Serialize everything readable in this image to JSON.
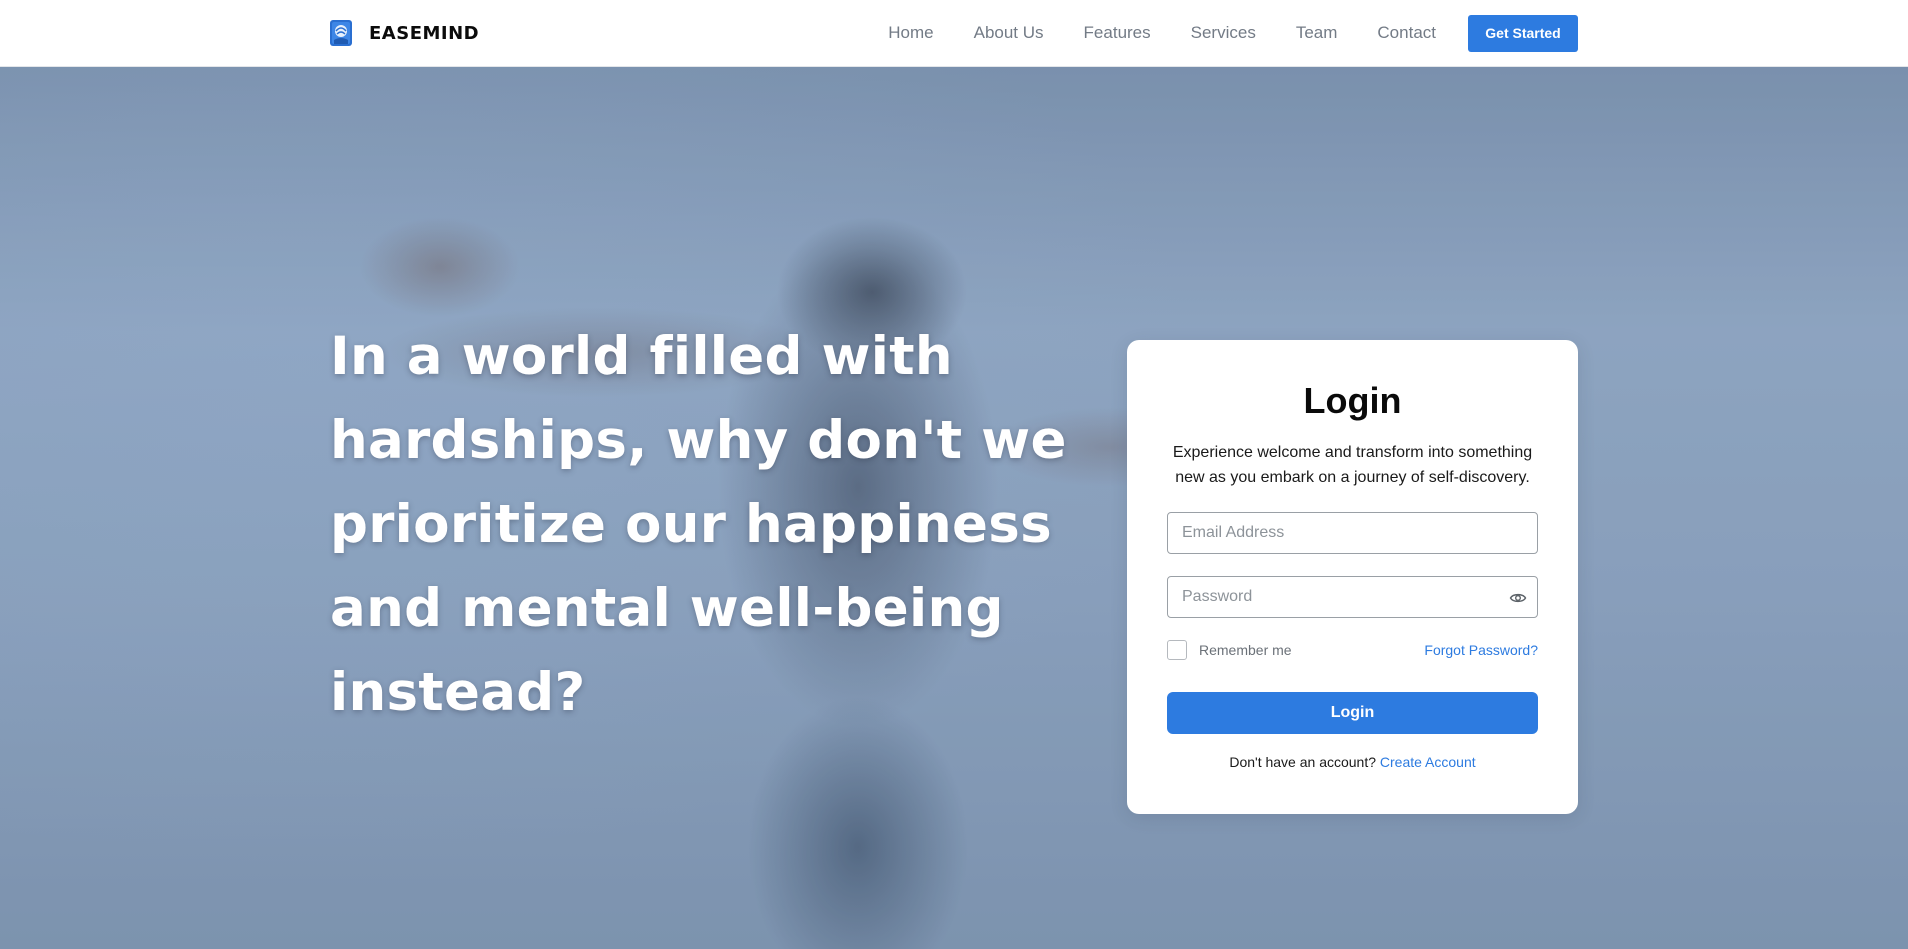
{
  "brand": {
    "name": "EASEMIND",
    "logo_icon": "easemind-logo-icon"
  },
  "nav": {
    "items": [
      {
        "label": "Home"
      },
      {
        "label": "About Us"
      },
      {
        "label": "Features"
      },
      {
        "label": "Services"
      },
      {
        "label": "Team"
      },
      {
        "label": "Contact"
      }
    ],
    "cta_label": "Get Started"
  },
  "hero": {
    "heading": "In a world filled with hardships, why don't we prioritize our happiness and mental well-being instead?"
  },
  "login": {
    "title": "Login",
    "subtitle": "Experience welcome and transform into something new as you embark on a journey of self-discovery.",
    "email_placeholder": "Email Address",
    "email_value": "",
    "password_placeholder": "Password",
    "password_value": "",
    "password_toggle_icon": "eye-icon",
    "remember_label": "Remember me",
    "remember_checked": false,
    "forgot_label": "Forgot Password?",
    "submit_label": "Login",
    "signup_prompt": "Don't have an account?",
    "signup_link": "Create Account"
  },
  "colors": {
    "accent": "#2d7be0",
    "nav_text": "#737b86",
    "header_bg": "#ffffff",
    "card_bg": "#ffffff"
  }
}
